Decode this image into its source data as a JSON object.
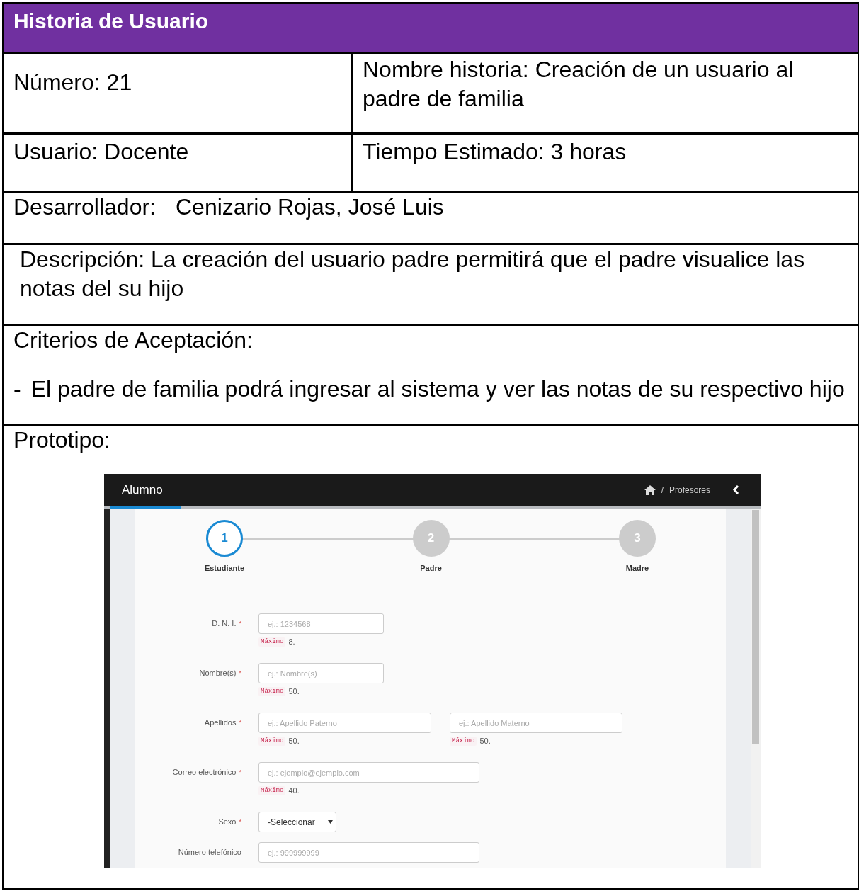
{
  "header": {
    "title": "Historia de Usuario"
  },
  "number": {
    "label": "Número:",
    "value": "21"
  },
  "story_name": {
    "label": "Nombre historia:",
    "value": "Creación de un usuario al padre de familia"
  },
  "user": {
    "label": "Usuario:",
    "value": "Docente"
  },
  "estimate": {
    "label": "Tiempo Estimado:",
    "value": "3 horas"
  },
  "developer": {
    "label": "Desarrollador:",
    "value": "Cenizario Rojas, José Luis"
  },
  "description": {
    "label": "Descripción:",
    "value": "La creación del usuario padre permitirá que el padre visualice las notas del su hijo"
  },
  "criteria": {
    "label": "Criterios de Aceptación:",
    "items": [
      {
        "bullet": "-",
        "text": "El padre de familia podrá ingresar al sistema y ver las notas de su respectivo hijo"
      }
    ]
  },
  "prototype": {
    "label": "Prototipo:",
    "app": {
      "title": "Alumno",
      "loading_bar": {
        "level": 0.11
      },
      "breadcrumb": {
        "separator": "/",
        "current": "Profesores"
      },
      "steps": [
        {
          "number": "1",
          "label": "Estudiante",
          "selected": true
        },
        {
          "number": "2",
          "label": "Padre",
          "selected": false
        },
        {
          "number": "3",
          "label": "Madre",
          "selected": false
        }
      ],
      "fields": [
        {
          "kind": "input",
          "label": "D. N. I.",
          "required_mark": "*",
          "inputs": [
            {
              "placeholder": "ej.: 1234568",
              "hint_code": "Máximo",
              "hint_text": "8."
            }
          ]
        },
        {
          "kind": "input",
          "label": "Nombre(s)",
          "required_mark": "*",
          "inputs": [
            {
              "placeholder": "ej.: Nombre(s)",
              "hint_code": "Máximo",
              "hint_text": "50."
            }
          ]
        },
        {
          "kind": "input",
          "label": "Apellidos",
          "required_mark": "*",
          "inputs": [
            {
              "placeholder": "ej.: Apellido Paterno",
              "hint_code": "Máximo",
              "hint_text": "50."
            },
            {
              "placeholder": "ej.: Apellido Materno",
              "hint_code": "Máximo",
              "hint_text": "50."
            }
          ]
        },
        {
          "kind": "input",
          "label": "Correo electrónico",
          "required_mark": "*",
          "inputs": [
            {
              "placeholder": "ej.: ejemplo@ejemplo.com",
              "hint_code": "Máximo",
              "hint_text": "40."
            }
          ]
        },
        {
          "kind": "select",
          "label": "Sexo",
          "required_mark": "*",
          "value": "-Seleccionar"
        },
        {
          "kind": "input",
          "label": "Número telefónico",
          "inputs": [
            {
              "placeholder": "ej.: 999999999"
            }
          ]
        }
      ]
    }
  }
}
